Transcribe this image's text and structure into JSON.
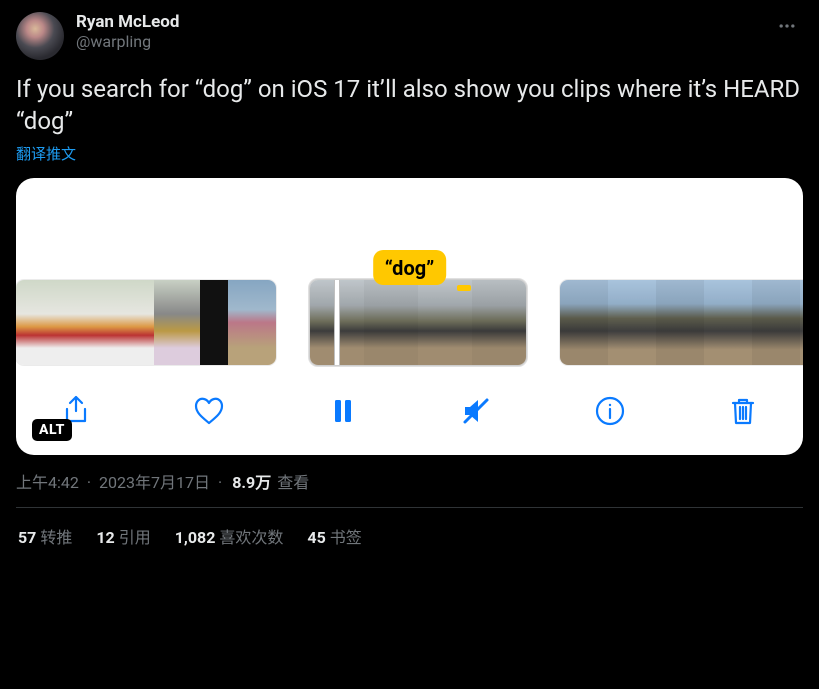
{
  "header": {
    "display_name": "Ryan McLeod",
    "handle": "@warpling"
  },
  "body": "If you search for “dog” on iOS 17 it’ll also show you clips where it’s HEARD “dog”",
  "translate_label": "翻译推文",
  "media": {
    "tooltip": "“dog”",
    "alt_badge": "ALT"
  },
  "meta": {
    "time": "上午4:42",
    "date": "2023年7月17日",
    "views_count": "8.9万",
    "views_label": "查看"
  },
  "stats": {
    "retweets": {
      "count": "57",
      "label": "转推"
    },
    "quotes": {
      "count": "12",
      "label": "引用"
    },
    "likes": {
      "count": "1,082",
      "label": "喜欢次数"
    },
    "bookmarks": {
      "count": "45",
      "label": "书签"
    }
  }
}
